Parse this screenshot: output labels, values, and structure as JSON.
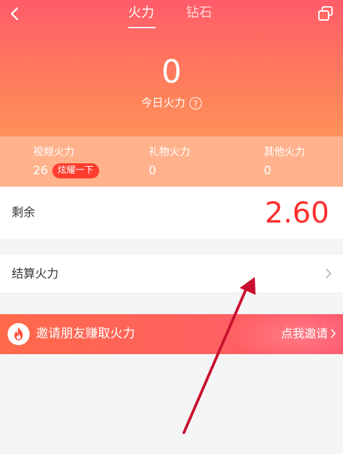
{
  "header": {
    "tabs": [
      {
        "label": "火力",
        "active": true
      },
      {
        "label": "钻石",
        "active": false
      }
    ]
  },
  "hero": {
    "value": "0",
    "label": "今日火力"
  },
  "stats": [
    {
      "name": "视频火力",
      "value": "26",
      "button": "炫耀一下"
    },
    {
      "name": "礼物火力",
      "value": "0"
    },
    {
      "name": "其他火力",
      "value": "0"
    }
  ],
  "remaining": {
    "label": "剩余",
    "amount": "2.60"
  },
  "settle": {
    "label": "结算火力"
  },
  "invite": {
    "text": "邀请朋友赚取火力",
    "cta": "点我邀请"
  },
  "colors": {
    "accent_red": "#ff2d2d",
    "hero_top": "#ff5c6a",
    "hero_bottom": "#ff925a",
    "stats_bg": "#ffb28c",
    "annotation_arrow": "#c8102e"
  },
  "icons": {
    "back": "back-arrow-icon",
    "share": "share-card-icon",
    "help": "question-circle-icon",
    "chevron": "chevron-right-icon",
    "fire": "fire-icon"
  }
}
